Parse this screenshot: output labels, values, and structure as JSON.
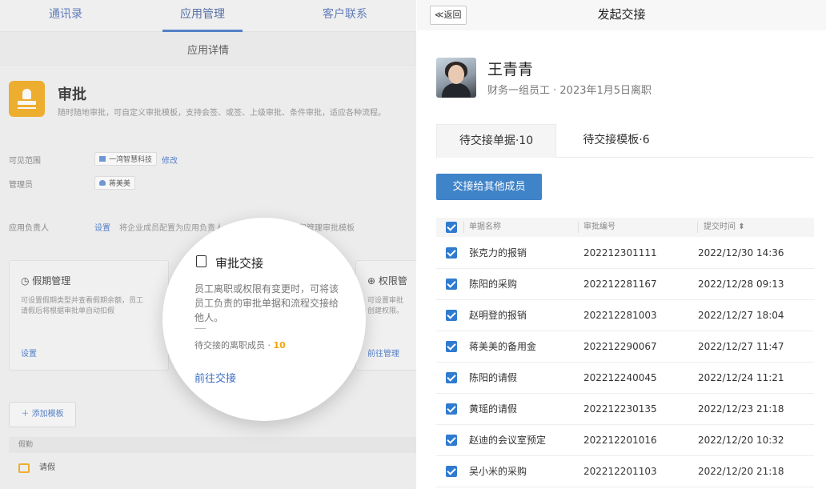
{
  "left": {
    "nav": {
      "contacts": "通讯录",
      "app_manage": "应用管理",
      "customer": "客户联系"
    },
    "subheader": "应用详情",
    "app": {
      "name": "审批",
      "description": "随时随地审批，可自定义审批模板，支持会签、或签、上级审批、条件审批，适应各种流程。"
    },
    "visible_scope": {
      "label": "可见范围",
      "value": "一湾智慧科技",
      "action": "修改"
    },
    "admin": {
      "label": "管理员",
      "value": "蒋美美"
    },
    "owner": {
      "label": "应用负责人",
      "action": "设置",
      "hint": "将企业成员配置为应用负责人",
      "hint_tail": "中创建和管理审批模板"
    },
    "box_leave": {
      "title": "假期管理",
      "desc_line1": "可设置假期类型并查看假期余额，员工",
      "desc_line2": "请假后将根据审批单自动扣假",
      "action": "设置"
    },
    "box_perm": {
      "title": "权限管",
      "desc_line1": "可设置审批",
      "desc_line2": "创建权限。",
      "action": "前往管理"
    },
    "add_template": "添加模板",
    "group_label": "假勤",
    "list_item": "请假",
    "magnifier": {
      "title": "审批交接",
      "desc": "员工离职或权限有变更时，可将该员工负责的审批单据和流程交接给他人。",
      "count_label": "待交接的离职成员 · ",
      "count": "10",
      "action": "前往交接"
    }
  },
  "right": {
    "back": "≪返回",
    "title": "发起交接",
    "user": {
      "name": "王青青",
      "info": "财务一组员工 · 2023年1月5日离职"
    },
    "tabs": {
      "pending_forms": "待交接单据·10",
      "pending_templates": "待交接模板·6"
    },
    "handover_button": "交接给其他成员",
    "columns": {
      "name": "单据名称",
      "number": "审批编号",
      "time": "提交时间"
    },
    "rows": [
      {
        "name": "张克力的报销",
        "number": "202212301111",
        "time": "2022/12/30 14:36"
      },
      {
        "name": "陈阳的采购",
        "number": "202212281167",
        "time": "2022/12/28 09:13"
      },
      {
        "name": "赵明登的报销",
        "number": "202212281003",
        "time": "2022/12/27 18:04"
      },
      {
        "name": "蒋美美的备用金",
        "number": "202212290067",
        "time": "2022/12/27 11:47"
      },
      {
        "name": "陈阳的请假",
        "number": "202212240045",
        "time": "2022/12/24 11:21"
      },
      {
        "name": "黄瑶的请假",
        "number": "202212230135",
        "time": "2022/12/23 21:18"
      },
      {
        "name": "赵迪的会议室预定",
        "number": "202212201016",
        "time": "2022/12/20 10:32"
      },
      {
        "name": "吴小米的采购",
        "number": "202212201103",
        "time": "2022/12/20 21:18"
      }
    ]
  },
  "colors": {
    "accent": "#3f83c8",
    "app_icon": "#f3a50c",
    "link": "#3a6fc4"
  }
}
